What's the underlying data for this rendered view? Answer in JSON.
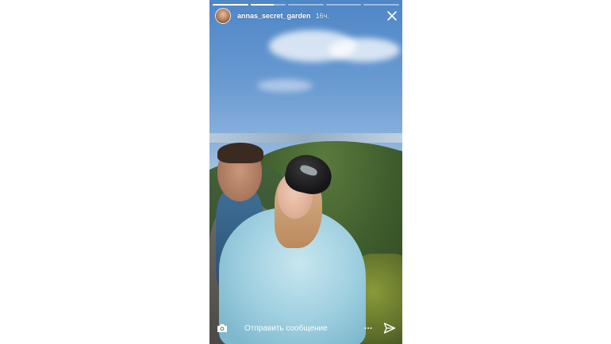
{
  "story": {
    "progress_segments": [
      {
        "fill": 1.0
      },
      {
        "fill": 0.65
      },
      {
        "fill": 0.0
      },
      {
        "fill": 0.0
      },
      {
        "fill": 0.0
      }
    ]
  },
  "header": {
    "username": "annas_secret_garden",
    "timestamp": "16ч.",
    "avatar_icon": "profile-avatar",
    "close_icon": "close-icon"
  },
  "footer": {
    "camera_icon": "camera-icon",
    "message_placeholder": "Отправить сообщение",
    "more_icon": "more-icon",
    "send_icon": "send-icon"
  },
  "colors": {
    "page_background": "#ffffff",
    "overlay_text": "#ffffff"
  }
}
